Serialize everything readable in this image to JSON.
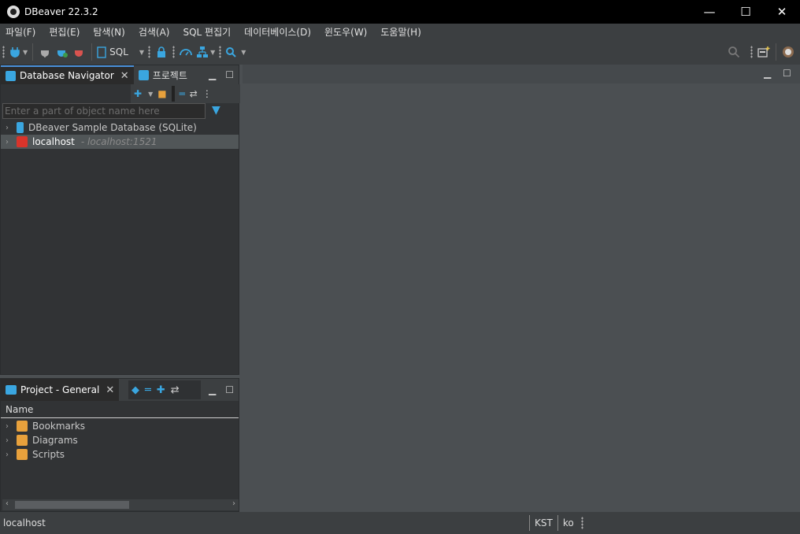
{
  "window": {
    "title": "DBeaver 22.3.2",
    "minimize": "—",
    "maximize": "☐",
    "close": "✕"
  },
  "menu": [
    "파일(F)",
    "편집(E)",
    "탐색(N)",
    "검색(A)",
    "SQL 편집기",
    "데이터베이스(D)",
    "윈도우(W)",
    "도움말(H)"
  ],
  "toolbar": {
    "sql_label": "SQL",
    "search_icon": "search-icon"
  },
  "navigator": {
    "tabs": [
      {
        "label": "Database Navigator",
        "close": "✕"
      },
      {
        "label": "프로젝트"
      }
    ],
    "filter_placeholder": "Enter a part of object name here",
    "tree": [
      {
        "label": "DBeaver Sample Database (SQLite)",
        "sub": ""
      },
      {
        "label": "localhost",
        "sub": "- localhost:1521"
      }
    ]
  },
  "project": {
    "tab_label": "Project - General",
    "tab_close": "✕",
    "column": "Name",
    "items": [
      "Bookmarks",
      "Diagrams",
      "Scripts"
    ]
  },
  "status": {
    "left": "localhost",
    "timezone": "KST",
    "locale": "ko"
  },
  "colors": {
    "accent": "#3aa6e0",
    "background": "#4b4f52",
    "panel": "#313335",
    "titlebar": "#000000"
  }
}
